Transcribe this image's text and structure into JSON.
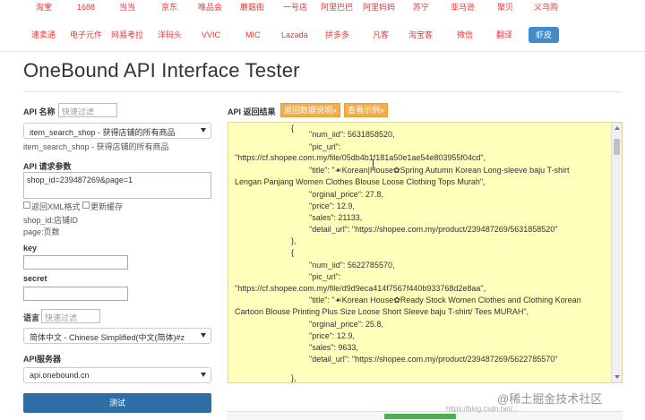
{
  "nav": {
    "row1": [
      "淘宝",
      "1688",
      "当当",
      "京东",
      "唯品会",
      "蘑菇街",
      "一号店",
      "阿里巴巴",
      "阿里妈妈",
      "苏宁",
      "亚马逊",
      "聚贝",
      "义乌购"
    ],
    "row2": [
      "速卖通",
      "电子元件",
      "网易考拉",
      "洋码头",
      "VVIC",
      "MIC",
      "Lazada",
      "拼多多",
      "凡客",
      "淘宝客",
      "微信",
      "翻译",
      "虾皮"
    ],
    "active": "虾皮",
    "link_color": "#e4393c",
    "active_color": "#428bca"
  },
  "page": {
    "title": "OneBound API Interface Tester"
  },
  "form": {
    "api_name_label": "API 名称",
    "api_filter_placeholder": "快速过滤",
    "api_select_value": "item_search_shop - 获得店铺的所有商品",
    "api_desc": "item_search_shop - 获得店铺的所有商品",
    "params_label": "API 请求参数",
    "params_value": "shop_id=239487269&page=1",
    "return_xml_label": "返回XML格式",
    "update_cache_label": "更新缓存",
    "param_hint_1": "shop_id:店铺ID",
    "param_hint_2": "page:页数",
    "key_label": "key",
    "secret_label": "secret",
    "lang_label": "语言",
    "lang_filter_placeholder": "快速过滤",
    "lang_select_value": "简体中文 - Chinese Simplified(中文(简体)#z",
    "server_label": "API服务器",
    "server_value": "api.onebound.cn",
    "submit_label": "测试",
    "submit_color": "#2f6ea5"
  },
  "result": {
    "label": "API 返回结果",
    "btn_doc": "返回数据说明»",
    "btn_example": "查看示例»",
    "panel_color": "#ffffbb",
    "lines": [
      "{",
      "\"num_iid\": 5631858520,",
      "\"pic_url\":",
      "\"https://cf.shopee.com.my/file/05db4b1f181a50e1ae54e803955f04cd\",",
      "\"title\": \"☙Korean|House✿Spring Autumn Korean Long-sleeve baju T-shirt",
      "Lengan Panjang Women Clothes Blouse Loose Clothing Tops Murah\",",
      "\"orginal_price\": 27.8,",
      "\"price\": 12.9,",
      "\"sales\": 21133,",
      "\"detail_url\": \"https://shopee.com.my/product/239487269/5631858520\"",
      "},",
      "{",
      "\"num_iid\": 5622785570,",
      "\"pic_url\":",
      "\"https://cf.shopee.com.my/file/d9d9eca414f7567f440b933768d2e8aa\",",
      "\"title\": \"☙Korean House✿Ready Stock Women Clothes and Clothing Korean",
      "Cartoon Blouse Printing Plus Size Loose Short Sleeve baju T-shirt/ Tees MURAH\",",
      "\"orginal_price\": 25.8,",
      "\"price\": 12.9,",
      "\"sales\": 9633,",
      "\"detail_url\": \"https://shopee.com.my/product/239487269/5622785570\"",
      "},"
    ]
  },
  "watermark": {
    "text": "@稀土掘金技术社区",
    "url": "https://blog.csdn.net/..."
  }
}
